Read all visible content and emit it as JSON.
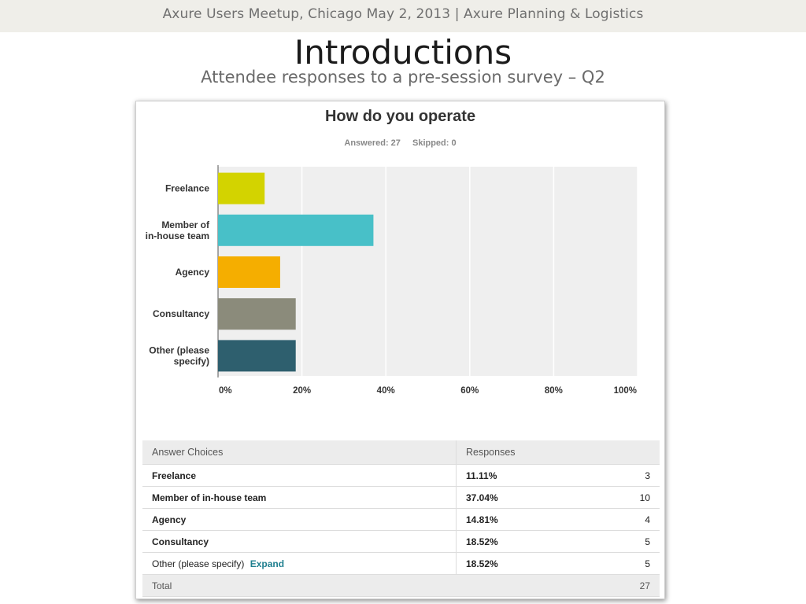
{
  "slide": {
    "header": "Axure Users Meetup, Chicago May 2, 2013  |  Axure Planning & Logistics",
    "title": "Introductions",
    "subtitle": "Attendee responses to a pre-session survey – Q2"
  },
  "survey": {
    "answered_label": "Answered: 27",
    "skipped_label": "Skipped: 0"
  },
  "chart_data": {
    "type": "bar",
    "orientation": "horizontal",
    "title": "How do you operate",
    "categories": [
      [
        "Freelance"
      ],
      [
        "Member of",
        "in-house team"
      ],
      [
        "Agency"
      ],
      [
        "Consultancy"
      ],
      [
        "Other (please",
        "specify)"
      ]
    ],
    "values": [
      11.11,
      37.04,
      14.81,
      18.52,
      18.52
    ],
    "colors": [
      "#d3d300",
      "#48c0c8",
      "#f5ae00",
      "#8b8b7b",
      "#2e5f6e"
    ],
    "xlim": [
      0,
      100
    ],
    "xticks": [
      "0%",
      "20%",
      "40%",
      "60%",
      "80%",
      "100%"
    ],
    "grid": true
  },
  "table": {
    "headers": {
      "choice": "Answer Choices",
      "responses": "Responses"
    },
    "rows": [
      {
        "choice": "Freelance",
        "pct": "11.11%",
        "count": "3"
      },
      {
        "choice": "Member of in-house team",
        "pct": "37.04%",
        "count": "10"
      },
      {
        "choice": "Agency",
        "pct": "14.81%",
        "count": "4"
      },
      {
        "choice": "Consultancy",
        "pct": "18.52%",
        "count": "5"
      },
      {
        "choice": "Other (please specify)",
        "pct": "18.52%",
        "count": "5",
        "link": "Expand"
      }
    ],
    "total_label": "Total",
    "total_count": "27"
  }
}
